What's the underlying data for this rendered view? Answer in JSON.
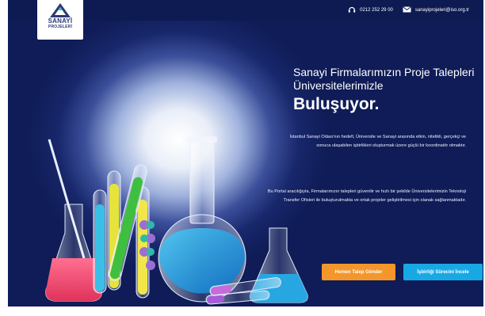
{
  "header": {
    "logo": {
      "line1": "SANAYİ",
      "line2": "PROJELERİ"
    },
    "phone": "0212 252 29 00",
    "email": "sanayiprojeleri@iso.org.tr"
  },
  "hero": {
    "title_line1": "Sanayi Firmalarımızın Proje Talepleri",
    "title_line2": "Üniversitelerimizle",
    "title_line3": "Buluşuyor.",
    "paragraph1": "İstanbul Sanayi Odası'nın hedefi, Üniversite ve Sanayi arasında etkin, nitelikli, gerçekçi ve sonuca ulaşabilen işbirlikleri oluşturmak üzere güçlü bir koordinatör olmaktır.",
    "paragraph2": "Bu Portal aracılığıyla, Firmalarımızın talepleri güvenilir ve hızlı bir şekilde Üniversitelerimizin Teknoloji Transfer Ofisleri ile buluşturulmakta ve ortak projeler geliştirilmesi için olanak sağlanmaktadır.",
    "buttons": {
      "primary": "Hemen Talep Gönder",
      "secondary": "İşbirliği Sürecini İncele"
    }
  },
  "colors": {
    "navy": "#0d1b52",
    "orange": "#f3962b",
    "blue": "#18a9e5"
  },
  "icons": [
    "phone-icon",
    "mail-icon",
    "logo-flask-icon"
  ]
}
